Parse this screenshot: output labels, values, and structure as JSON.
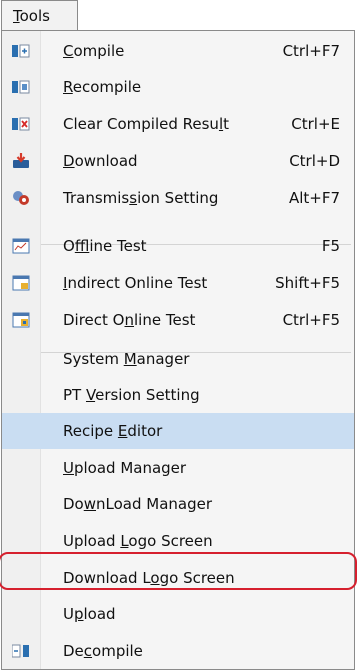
{
  "menu_tab": {
    "label": "Tools",
    "underline_index": 0
  },
  "items": [
    {
      "id": "compile",
      "label": "Compile",
      "u": 0,
      "shortcut": "Ctrl+F7",
      "icon": "compile-icon"
    },
    {
      "id": "recompile",
      "label": "Recompile",
      "u": 0,
      "shortcut": "",
      "icon": "recompile-icon"
    },
    {
      "id": "clear-compiled-result",
      "label": "Clear Compiled Result",
      "u": 19,
      "shortcut": "Ctrl+E",
      "icon": "clear-compile-icon"
    },
    {
      "id": "download",
      "label": "Download",
      "u": 0,
      "shortcut": "Ctrl+D",
      "icon": "download-icon"
    },
    {
      "id": "transmission-setting",
      "label": "Transmission Setting",
      "u": 8,
      "shortcut": "Alt+F7",
      "icon": "transmission-icon"
    },
    {
      "id": "offline-test",
      "label": "Offline Test",
      "u": 1,
      "shortcut": "F5",
      "icon": "offline-test-icon"
    },
    {
      "id": "indirect-online-test",
      "label": "Indirect Online Test",
      "u": 0,
      "shortcut": "Shift+F5",
      "icon": "indirect-online-test-icon"
    },
    {
      "id": "direct-online-test",
      "label": "Direct Online Test",
      "u": 8,
      "shortcut": "Ctrl+F5",
      "icon": "direct-online-test-icon"
    },
    {
      "id": "system-manager",
      "label": "System Manager",
      "u": 7,
      "shortcut": "",
      "icon": ""
    },
    {
      "id": "pt-version-setting",
      "label": "PT Version Setting",
      "u": 3,
      "shortcut": "",
      "icon": ""
    },
    {
      "id": "recipe-editor",
      "label": "Recipe Editor",
      "u": 7,
      "shortcut": "",
      "icon": ""
    },
    {
      "id": "upload-manager",
      "label": "Upload Manager",
      "u": 0,
      "shortcut": "",
      "icon": ""
    },
    {
      "id": "download-manager",
      "label": "DownLoad Manager",
      "u": 2,
      "shortcut": "",
      "icon": ""
    },
    {
      "id": "upload-logo-screen",
      "label": "Upload Logo Screen",
      "u": 7,
      "shortcut": "",
      "icon": ""
    },
    {
      "id": "download-logo-screen",
      "label": "Download Logo Screen",
      "u": 10,
      "shortcut": "",
      "icon": ""
    },
    {
      "id": "upload",
      "label": "Upload",
      "u": 1,
      "shortcut": "",
      "icon": ""
    },
    {
      "id": "decompile",
      "label": "Decompile",
      "u": 2,
      "shortcut": "",
      "icon": "decompile-icon"
    }
  ],
  "selected_item": "recipe-editor",
  "colors": {
    "highlight_border": "#d6202e",
    "selected_bg": "#c9ddf2"
  }
}
